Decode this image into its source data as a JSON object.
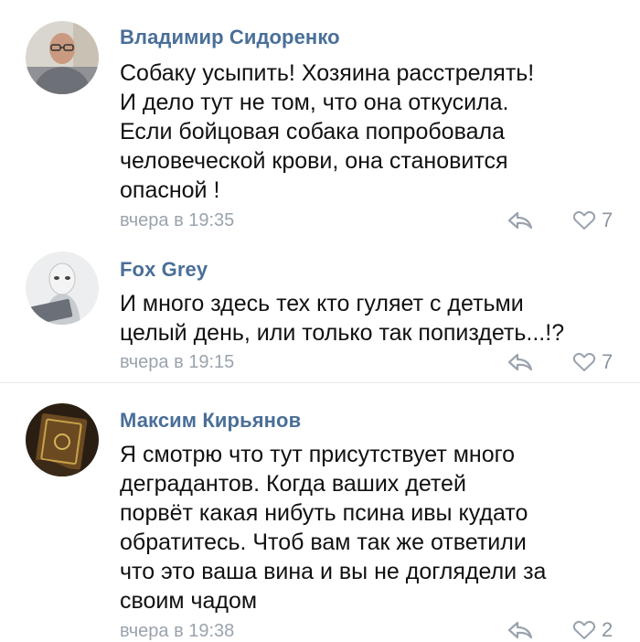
{
  "comments": [
    {
      "author": "Владимир Сидоренко",
      "lines": [
        "Собаку усыпить! Хозяина расстрелять!",
        "И дело тут не том, что она откусила.",
        "Если бойцовая собака попробовала",
        "человеческой крови, она становится",
        "опасной !"
      ],
      "date": "вчера в 19:35",
      "likes": "7",
      "avatar": "avatar-man-glasses"
    },
    {
      "author": "Fox Grey",
      "lines": [
        "И много здесь тех кто гуляет с детьми",
        "целый день, или только так попиздеть...!?"
      ],
      "date": "вчера в 19:15",
      "likes": "7",
      "avatar": "avatar-masked-hacker"
    },
    {
      "author": "Максим Кирьянов",
      "lines": [
        "Я смотрю что тут присутствует много",
        "деградантов. Когда ваших детей",
        "порвёт какая нибуть псина ивы кудато",
        "обратитесь. Чтоб вам так же ответили",
        "что это ваша вина и вы не доглядели за",
        "своим чадом"
      ],
      "date": "вчера в 19:38",
      "likes": "2",
      "avatar": "avatar-old-book"
    }
  ],
  "colors": {
    "author": "#4a6f98",
    "text": "#111111",
    "meta": "#9aa3ad",
    "divider": "#e6e9ec"
  },
  "icons": {
    "reply": "reply-arrow-icon",
    "like": "heart-outline-icon"
  }
}
